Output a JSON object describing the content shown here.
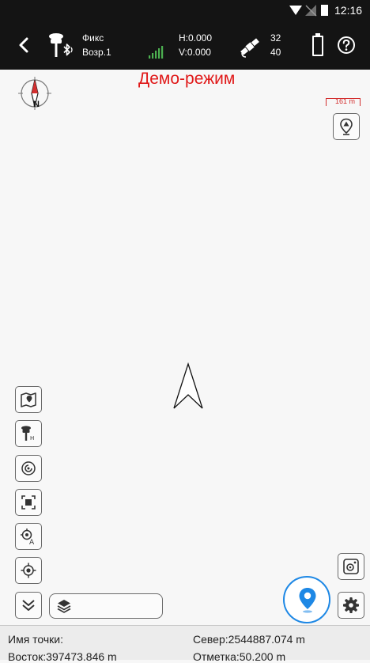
{
  "status_bar": {
    "time": "12:16",
    "icons": [
      "wifi-icon",
      "signal-muted-icon",
      "battery-icon"
    ]
  },
  "top_bar": {
    "solution_status": "Фикс",
    "receiver_name": "Возр.1",
    "h_precision": "H:0.000",
    "v_precision": "V:0.000",
    "satellites_used": "32",
    "satellites_tracked": "40",
    "icons": [
      "back-arrow-icon",
      "gnss-receiver-bluetooth-icon",
      "signal-strength-icon",
      "satellite-icon",
      "battery-status-icon",
      "help-icon"
    ]
  },
  "map": {
    "demo_mode_label": "Демо-режим",
    "scale_label": "161 m",
    "compass_north_label": "N",
    "left_toolbar": [
      "map-view-icon",
      "receiver-height-icon",
      "stakeout-target-icon",
      "zoom-extent-icon",
      "auto-center-icon",
      "locate-icon",
      "collapse-icon"
    ],
    "right_toolbar": [
      "map-point-icon",
      "camera-point-icon",
      "settings-icon"
    ],
    "colors": {
      "demo_mode": "#e01818",
      "accent": "#1e88e5",
      "scale_bar": "#d32f2f"
    }
  },
  "bottom_panel": {
    "point_name_label": "Имя точки:",
    "north_value": "Север:2544887.074 m",
    "east_value": "Восток:397473.846 m",
    "elevation_value": "Отметка:50.200 m"
  }
}
